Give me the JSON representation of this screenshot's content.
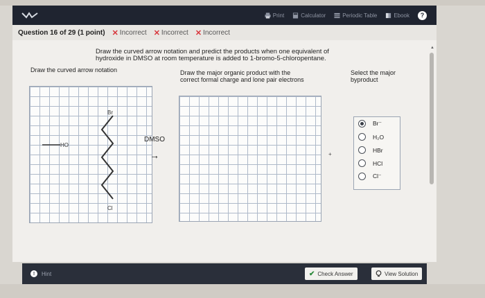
{
  "toolbar": {
    "items": [
      {
        "label": "Print",
        "icon": "print-icon"
      },
      {
        "label": "Calculator",
        "icon": "calculator-icon"
      },
      {
        "label": "Periodic Table",
        "icon": "periodic-table-icon"
      },
      {
        "label": "Ebook",
        "icon": "ebook-icon"
      }
    ],
    "help": "?"
  },
  "header": {
    "question": "Question 16 of 29 (1 point)",
    "attempts": [
      "Incorrect",
      "Incorrect",
      "Incorrect"
    ]
  },
  "prompt": {
    "line1": "Draw the curved arrow notation and predict the products when one equivalent of",
    "line2": "hydroxide in DMSO at room temperature is added to 1-bromo-5-chloropentane."
  },
  "labels": {
    "curved_arrow": "Draw the curved arrow notation",
    "major_line1": "Draw the major organic product with the",
    "major_line2": "correct formal charge and lone pair electrons",
    "byproduct_line1": "Select the major",
    "byproduct_line2": "byproduct"
  },
  "reaction": {
    "solvent": "DMSO",
    "arrow": "→",
    "plus": "+"
  },
  "molecule": {
    "br": "Br",
    "cl": "Cl",
    "ho": "HO"
  },
  "byproduct": {
    "options": [
      {
        "label": "Br⁻",
        "selected": true
      },
      {
        "label": "H₂O",
        "selected": false
      },
      {
        "label": "HBr",
        "selected": false
      },
      {
        "label": "HCl",
        "selected": false
      },
      {
        "label": "Cl⁻",
        "selected": false
      }
    ]
  },
  "footer": {
    "hint": "Hint",
    "check": "Check Answer",
    "solution": "View Solution"
  },
  "colors": {
    "toolbar": "#1f2430",
    "incorrect": "#d8353b",
    "check_green": "#2e8b3e"
  }
}
